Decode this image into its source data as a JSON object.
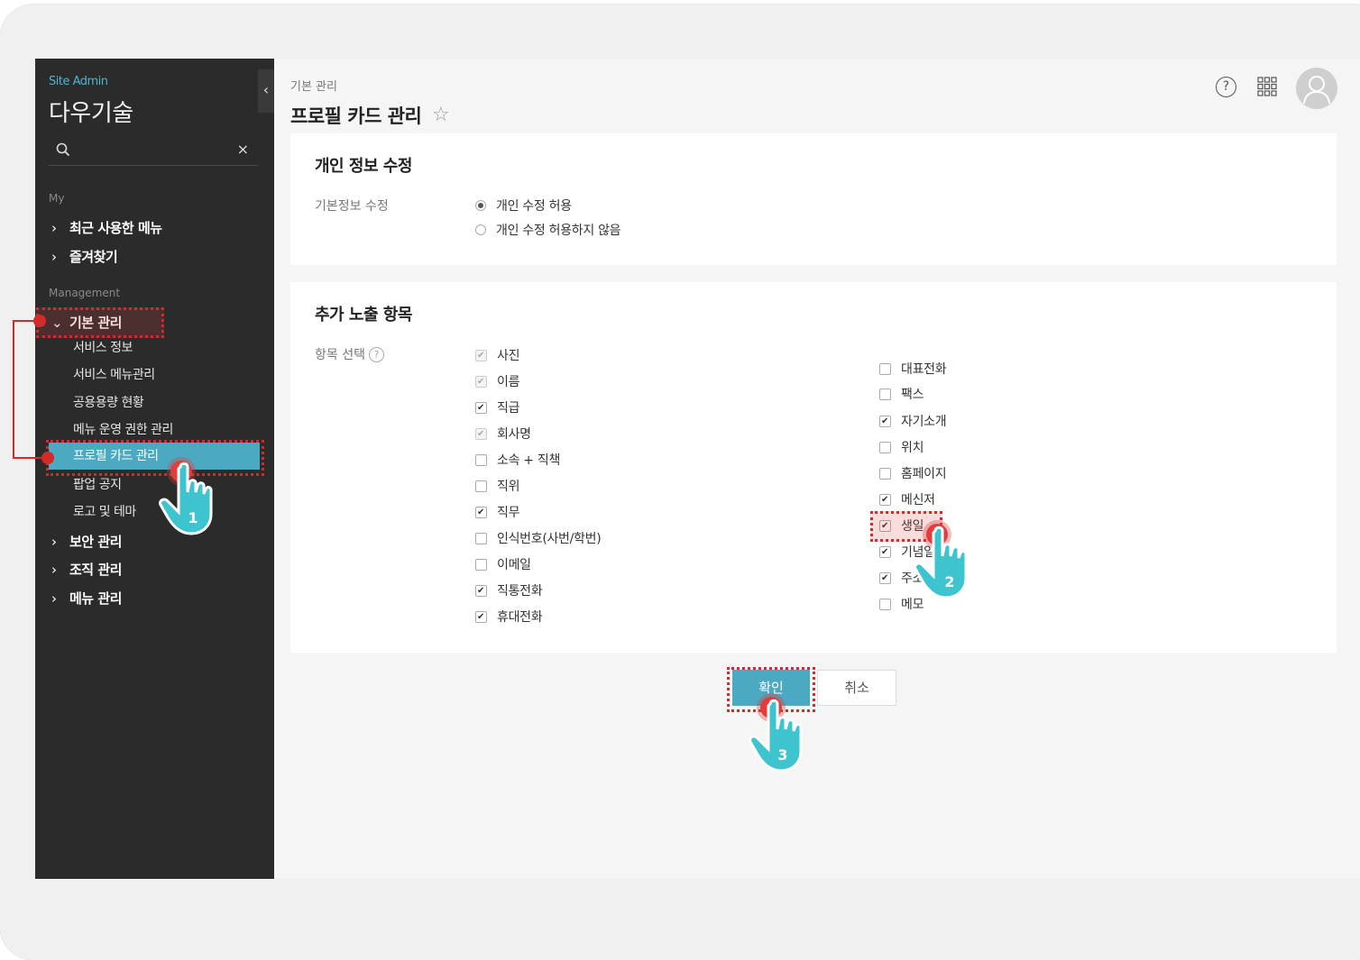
{
  "sidebar": {
    "brand_small": "Site Admin",
    "brand_large": "다우기술",
    "search": {
      "placeholder": "",
      "clear_label": "×"
    },
    "collapse_label": "‹",
    "my_label": "My",
    "my_items": [
      {
        "label": "최근 사용한 메뉴"
      },
      {
        "label": "즐겨찾기"
      }
    ],
    "management_label": "Management",
    "management_group": {
      "label": "기본 관리"
    },
    "management_sub": [
      {
        "label": "서비스 정보"
      },
      {
        "label": "서비스 메뉴관리"
      },
      {
        "label": "공용용량 현황"
      },
      {
        "label": "메뉴 운영 권한 관리"
      },
      {
        "label": "프로필 카드 관리"
      },
      {
        "label": "팝업 공지"
      },
      {
        "label": "로고 및 테마"
      }
    ],
    "other_groups": [
      {
        "label": "보안 관리"
      },
      {
        "label": "조직 관리"
      },
      {
        "label": "메뉴 관리"
      }
    ]
  },
  "header": {
    "breadcrumb": "기본 관리",
    "title": "프로필 카드 관리",
    "star_icon": "star-outline-icon",
    "help_label": "?"
  },
  "personal_panel": {
    "title": "개인 정보 수정",
    "field_label": "기본정보 수정",
    "options": [
      {
        "label": "개인 수정 허용",
        "selected": true
      },
      {
        "label": "개인 수정 허용하지 않음",
        "selected": false
      }
    ]
  },
  "extra_panel": {
    "title": "추가 노출 항목",
    "field_label": "항목 선택",
    "help_label": "?",
    "left_items": [
      {
        "label": "사진",
        "checked": true,
        "disabled": true
      },
      {
        "label": "이름",
        "checked": true,
        "disabled": true
      },
      {
        "label": "직급",
        "checked": true,
        "disabled": false
      },
      {
        "label": "회사명",
        "checked": true,
        "disabled": true
      },
      {
        "label": "소속 + 직책",
        "checked": false,
        "disabled": false
      },
      {
        "label": "직위",
        "checked": false,
        "disabled": false
      },
      {
        "label": "직무",
        "checked": true,
        "disabled": false
      },
      {
        "label": "인식번호(사번/학번)",
        "checked": false,
        "disabled": false
      },
      {
        "label": "이메일",
        "checked": false,
        "disabled": false
      },
      {
        "label": "직통전화",
        "checked": true,
        "disabled": false
      },
      {
        "label": "휴대전화",
        "checked": true,
        "disabled": false
      }
    ],
    "right_items": [
      {
        "label": "대표전화",
        "checked": false
      },
      {
        "label": "팩스",
        "checked": false
      },
      {
        "label": "자기소개",
        "checked": true
      },
      {
        "label": "위치",
        "checked": false
      },
      {
        "label": "홈페이지",
        "checked": false
      },
      {
        "label": "메신저",
        "checked": true
      },
      {
        "label": "생일",
        "checked": true
      },
      {
        "label": "기념일",
        "checked": true
      },
      {
        "label": "주소",
        "checked": true
      },
      {
        "label": "메모",
        "checked": false
      }
    ]
  },
  "buttons": {
    "confirm": "확인",
    "cancel": "취소"
  },
  "annotations": {
    "step1": "1",
    "step2": "2",
    "step3": "3"
  },
  "colors": {
    "accent": "#4ba9c2",
    "sidebar_bg": "#2b2b2b",
    "annotation_red": "#d42a2a",
    "hand_teal": "#3ec4cf"
  }
}
